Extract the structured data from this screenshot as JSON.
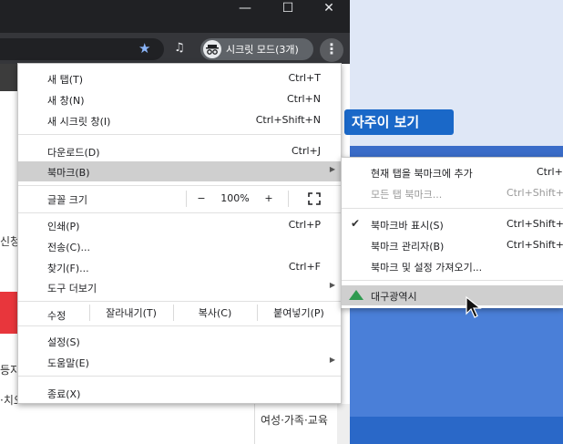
{
  "window": {
    "minimize_glyph": "—",
    "maximize_glyph": "☐",
    "close_glyph": "✕"
  },
  "toolbar": {
    "star_icon": "star-icon",
    "media_icon": "media-control-icon",
    "incognito_label": "시크릿 모드(3개)",
    "menu_icon": "⋮"
  },
  "page_behind": {
    "button_text": "자주이 보기",
    "left_text_1": "신청",
    "left_text_2": "등지",
    "left_text_3": "·치오",
    "bottom_text": "여성·가족·교육"
  },
  "menu": {
    "new_tab": {
      "label": "새 탭(T)",
      "shortcut": "Ctrl+T"
    },
    "new_window": {
      "label": "새 창(N)",
      "shortcut": "Ctrl+N"
    },
    "new_incognito": {
      "label": "새 시크릿 창(I)",
      "shortcut": "Ctrl+Shift+N"
    },
    "downloads": {
      "label": "다운로드(D)",
      "shortcut": "Ctrl+J"
    },
    "bookmarks": {
      "label": "북마크(B)"
    },
    "zoom": {
      "label": "글꼴 크기",
      "minus": "−",
      "value": "100%",
      "plus": "+"
    },
    "print": {
      "label": "인쇄(P)",
      "shortcut": "Ctrl+P"
    },
    "cast": {
      "label": "전송(C)..."
    },
    "find": {
      "label": "찾기(F)...",
      "shortcut": "Ctrl+F"
    },
    "more_tools": {
      "label": "도구 더보기"
    },
    "edit": {
      "label": "수정",
      "cut": "잘라내기(T)",
      "copy": "복사(C)",
      "paste": "붙여넣기(P)"
    },
    "settings": {
      "label": "설정(S)"
    },
    "help": {
      "label": "도움말(E)"
    },
    "exit": {
      "label": "종료(X)"
    }
  },
  "bookmark_submenu": {
    "bookmark_tab": {
      "label": "현재 탭을 북마크에 추가",
      "shortcut": "Ctrl+"
    },
    "bookmark_all": {
      "label": "모든 탭 북마크...",
      "shortcut": "Ctrl+Shift+"
    },
    "show_bar": {
      "label": "북마크바 표시(S)",
      "shortcut": "Ctrl+Shift+"
    },
    "manager": {
      "label": "북마크 관리자(B)",
      "shortcut": "Ctrl+Shift+O"
    },
    "import": {
      "label": "북마크 및 설정 가져오기..."
    },
    "folder": {
      "label": "대구광역시"
    }
  }
}
